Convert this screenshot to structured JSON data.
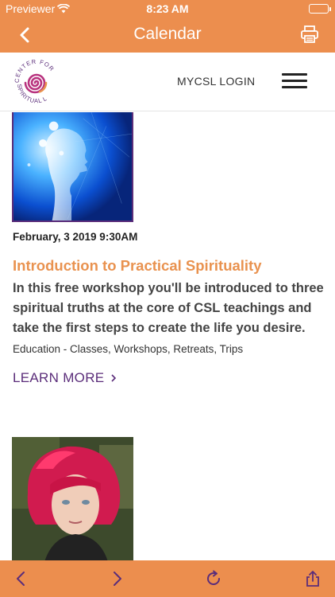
{
  "status_bar": {
    "carrier": "Previewer",
    "time": "8:23 AM"
  },
  "nav": {
    "title": "Calendar",
    "back_icon": "chevron-left-icon",
    "print_icon": "printer-icon"
  },
  "header": {
    "logo_text": "CENTER FOR SPIRITUAL LIVING",
    "login_label": "MYCSL LOGIN",
    "menu_icon": "hamburger-menu-icon"
  },
  "event": {
    "date": "February, 3 2019 9:30AM",
    "title": "Introduction to Practical Spirituality",
    "description": "In this free workshop you'll be introduced to three spiritual truths at the core of CSL teachings and take the first steps to create the life you desire.",
    "category": "Education - Classes, Workshops, Retreats, Trips",
    "learn_more": "LEARN MORE",
    "learn_more_icon": "chevron-right-icon"
  },
  "toolbar": {
    "back_icon": "arrow-left-icon",
    "forward_icon": "arrow-right-icon",
    "reload_icon": "reload-icon",
    "share_icon": "share-icon"
  },
  "colors": {
    "brand_orange": "#ec8e4e",
    "title_orange": "#e9924f",
    "brand_purple": "#5b2d7a"
  }
}
